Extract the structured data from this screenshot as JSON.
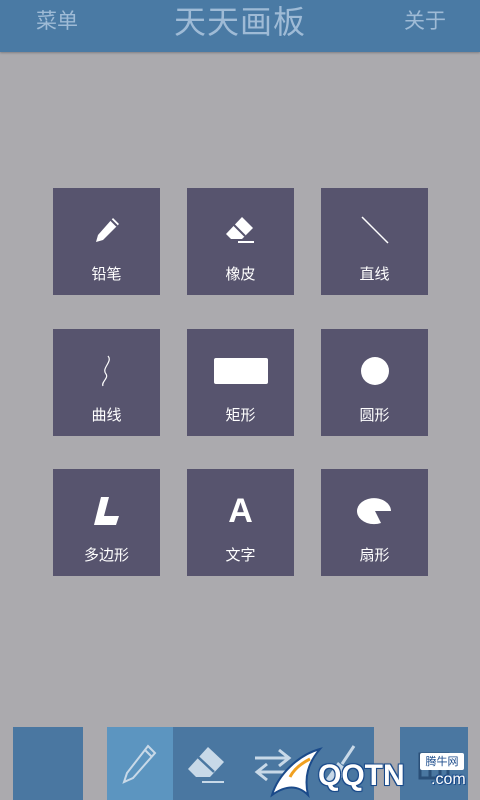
{
  "header": {
    "menu_label": "菜单",
    "title": "天天画板",
    "about_label": "关于",
    "background": "#4a7aa4"
  },
  "tools": [
    {
      "label": "铅笔",
      "icon": "pencil-icon"
    },
    {
      "label": "橡皮",
      "icon": "eraser-icon"
    },
    {
      "label": "直线",
      "icon": "line-icon"
    },
    {
      "label": "曲线",
      "icon": "curve-icon"
    },
    {
      "label": "矩形",
      "icon": "rectangle-icon"
    },
    {
      "label": "圆形",
      "icon": "circle-icon"
    },
    {
      "label": "多边形",
      "icon": "polygon-icon"
    },
    {
      "label": "文字",
      "icon": "text-icon",
      "glyph": "A"
    },
    {
      "label": "扇形",
      "icon": "sector-icon"
    }
  ],
  "toolbar": {
    "items": [
      {
        "icon": "pencil-icon",
        "active": true
      },
      {
        "icon": "eraser-icon",
        "active": false
      },
      {
        "icon": "swap-arrows-icon",
        "active": false
      },
      {
        "icon": "broom-icon",
        "active": false
      }
    ],
    "layers_icon": "layers-icon",
    "color": "#4a77a1"
  },
  "watermark": {
    "text": "QQTN",
    "suffix": ".com",
    "badge": "腾牛网"
  },
  "colors": {
    "canvas": "#abaaae",
    "tile": "#57546e",
    "active_tool": "#5c95c0"
  }
}
